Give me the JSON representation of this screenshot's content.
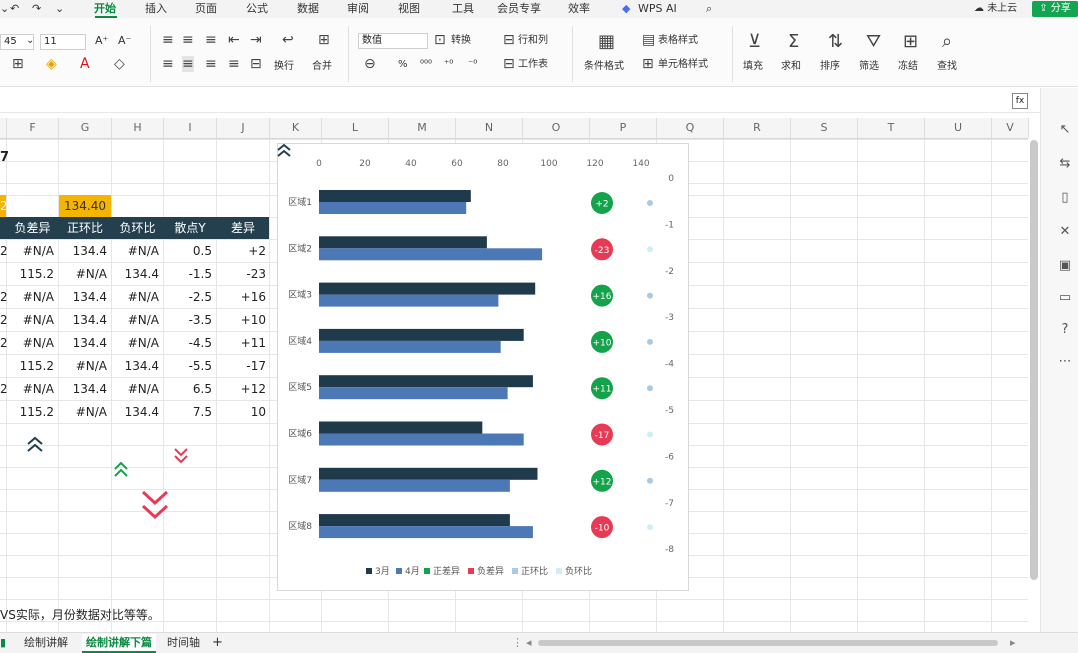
{
  "menu": {
    "items": [
      "开始",
      "插入",
      "页面",
      "公式",
      "数据",
      "审阅",
      "视图",
      "工具",
      "会员专享",
      "效率",
      "WPS AI"
    ],
    "cloud": "未上云",
    "share": "分享"
  },
  "ribbon": {
    "font_size": "45",
    "font_size2": "11",
    "number_format": "数值",
    "convert": "转换",
    "row_col": "行和列",
    "worksheet": "工作表",
    "cond_format": "条件格式",
    "table_style": "表格样式",
    "cell_style": "单元格样式",
    "sum": "求和",
    "filter": "筛选",
    "sort": "排序",
    "fill": "填充",
    "find": "查找",
    "freeze": "冻结",
    "wrap": "换行",
    "merge": "合并"
  },
  "formula_bar": {
    "fx": "fx"
  },
  "columns": [
    "F",
    "G",
    "H",
    "I",
    "J",
    "K",
    "L",
    "M",
    "N",
    "O",
    "P",
    "Q",
    "R",
    "S",
    "T",
    "U",
    "V"
  ],
  "cells": {
    "row1_val": "7",
    "row3_f": "2",
    "row3_g": "134.40",
    "headers": [
      "负差异",
      "正环比",
      "负环比",
      "散点Y",
      "差异"
    ],
    "rows": [
      {
        "e": "2",
        "f": "#N/A",
        "g": "134.4",
        "h": "#N/A",
        "i": "0.5",
        "j": "+2"
      },
      {
        "e": "",
        "f": "115.2",
        "g": "#N/A",
        "h": "134.4",
        "i": "-1.5",
        "j": "-23"
      },
      {
        "e": "2",
        "f": "#N/A",
        "g": "134.4",
        "h": "#N/A",
        "i": "-2.5",
        "j": "+16"
      },
      {
        "e": "2",
        "f": "#N/A",
        "g": "134.4",
        "h": "#N/A",
        "i": "-3.5",
        "j": "+10"
      },
      {
        "e": "2",
        "f": "#N/A",
        "g": "134.4",
        "h": "#N/A",
        "i": "-4.5",
        "j": "+11"
      },
      {
        "e": "",
        "f": "115.2",
        "g": "#N/A",
        "h": "134.4",
        "i": "-5.5",
        "j": "-17"
      },
      {
        "e": "2",
        "f": "#N/A",
        "g": "134.4",
        "h": "#N/A",
        "i": "6.5",
        "j": "+12"
      },
      {
        "e": "",
        "f": "115.2",
        "g": "#N/A",
        "h": "134.4",
        "i": "7.5",
        "j": "10"
      }
    ],
    "note": "VS实际，月份数据对比等等。"
  },
  "colors": {
    "accent": "#0b8a43",
    "header_bg": "#24404f",
    "highlight": "#f5b400",
    "series_3": "#1f3a4b",
    "series_4": "#4c79b6",
    "pos": "#14a24a",
    "neg": "#e83a55"
  },
  "chart_data": {
    "type": "bar",
    "categories": [
      "区域1",
      "区域2",
      "区域3",
      "区域4",
      "区域5",
      "区域6",
      "区域7",
      "区域8"
    ],
    "series": [
      {
        "name": "3月",
        "values": [
          66,
          73,
          94,
          89,
          93,
          71,
          95,
          83
        ]
      },
      {
        "name": "4月",
        "values": [
          64,
          97,
          78,
          79,
          82,
          89,
          83,
          93
        ]
      }
    ],
    "diff_labels": [
      "+2",
      "-23",
      "+16",
      "+10",
      "+11",
      "-17",
      "+12",
      "-10"
    ],
    "x_ticks": [
      "0",
      "20",
      "40",
      "60",
      "80",
      "100",
      "120",
      "140"
    ],
    "xlim": [
      0,
      140
    ],
    "y2_ticks": [
      "0",
      "-1",
      "-2",
      "-3",
      "-4",
      "-5",
      "-6",
      "-7",
      "-8"
    ],
    "legend": [
      "3月",
      "4月",
      "正差异",
      "负差异",
      "正环比",
      "负环比"
    ],
    "legend_position": "bottom"
  },
  "sheets": [
    "绘制讲解",
    "绘制讲解下篇",
    "时间轴",
    "+"
  ]
}
